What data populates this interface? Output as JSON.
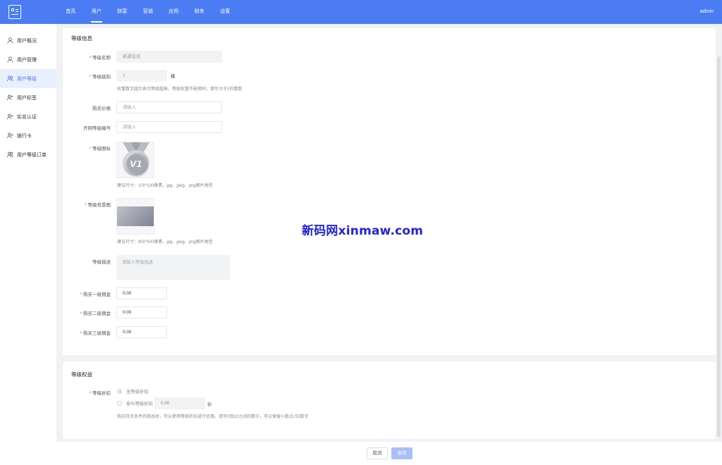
{
  "header": {
    "nav": [
      "首页",
      "用户",
      "财富",
      "营销",
      "应用",
      "财务",
      "设置"
    ],
    "active_nav": "用户",
    "user": "admin",
    "accent": "#4b7cf3"
  },
  "sidebar": {
    "items": [
      {
        "label": "用户概况",
        "icon": "user-icon"
      },
      {
        "label": "用户管理",
        "icon": "user-icon"
      },
      {
        "label": "用户等级",
        "icon": "users-icon",
        "active": true
      },
      {
        "label": "用户标签",
        "icon": "users-icon"
      },
      {
        "label": "实名认证",
        "icon": "users-icon"
      },
      {
        "label": "银行卡",
        "icon": "users-icon"
      },
      {
        "label": "用户等级订单",
        "icon": "users-icon"
      }
    ]
  },
  "level_info": {
    "title": "等级信息",
    "name_label": "等级名称",
    "name_value": "新通会员",
    "level_label": "等级级别",
    "level_value": "1",
    "level_unit": "级",
    "level_hint": "权重数字越大表示等级越高，等级权重不能相同，填写大于1的整数",
    "price_label": "购买价格",
    "price_placeholder": "请输入",
    "code_label": "开网等级编号",
    "code_placeholder": "请输入",
    "icon_label": "等级图标",
    "icon_hint": "建议尺寸：100*100像素，jpg、jpeg、png图片类型",
    "icon_text": "V1",
    "bg_label": "等级背景图",
    "bg_hint": "建议尺寸：800*500像素，jpg、jpeg、png图片类型",
    "desc_label": "等级描述",
    "desc_placeholder": "请输入等级描述",
    "commission1_label": "购买一级佣金",
    "commission1_value": "0.00",
    "commission2_label": "购买二级佣金",
    "commission2_value": "0.00",
    "commission3_label": "购买三级佣金",
    "commission3_value": "0.00"
  },
  "level_rights": {
    "title": "等级权益",
    "discount_label": "等级折扣",
    "option1": "无等级折扣",
    "option2": "参与等级折扣",
    "discount_value": "0.00",
    "discount_unit": "折",
    "hint": "购买符合条件的商品时，可以使用等级折扣进行优惠。请写0到10之间的数字，可以保留小数点2位数字"
  },
  "watermark": "新码网xinmaw.com",
  "footer": {
    "cancel": "取消",
    "save": "保存"
  }
}
